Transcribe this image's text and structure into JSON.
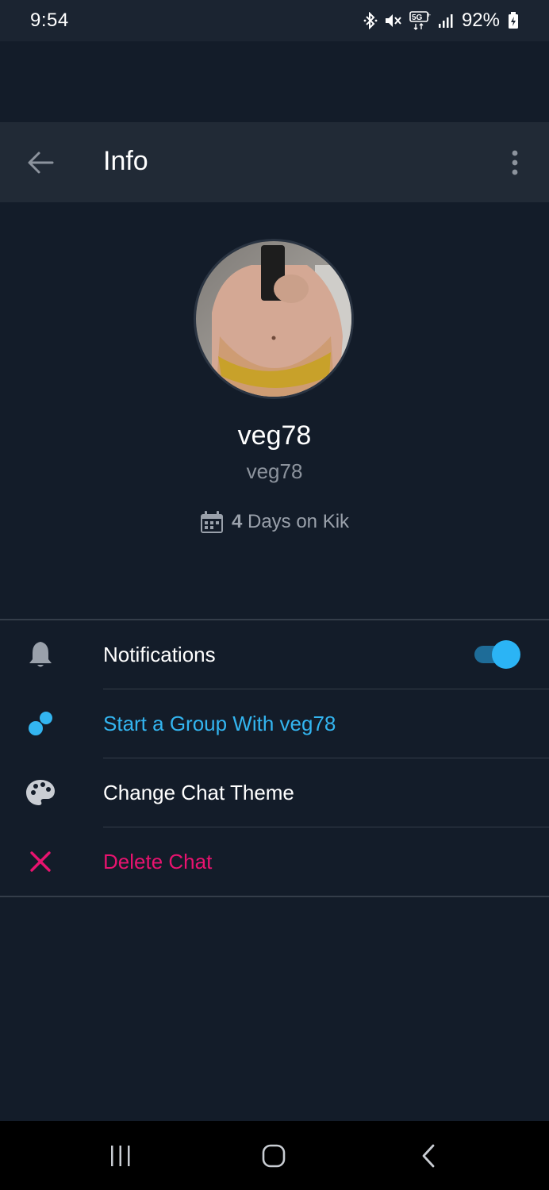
{
  "status_bar": {
    "time": "9:54",
    "battery": "92%",
    "icons": [
      "bluetooth-icon",
      "mute-icon",
      "5g-icon",
      "signal-icon",
      "battery-charging-icon"
    ]
  },
  "app_bar": {
    "title": "Info",
    "back_icon": "arrow-left-icon",
    "more_icon": "more-vertical-icon"
  },
  "profile": {
    "display_name": "veg78",
    "username": "veg78",
    "days_count": "4",
    "days_suffix": "Days on Kik",
    "calendar_icon": "calendar-icon"
  },
  "menu": {
    "notifications": {
      "label": "Notifications",
      "icon": "bell-icon",
      "enabled": true
    },
    "start_group": {
      "label": "Start a Group With veg78",
      "icon": "group-dots-icon"
    },
    "change_theme": {
      "label": "Change Chat Theme",
      "icon": "palette-icon"
    },
    "delete_chat": {
      "label": "Delete Chat",
      "icon": "close-icon"
    }
  },
  "colors": {
    "background": "#131c29",
    "app_bar": "#212a36",
    "accent_blue": "#33b5f0",
    "delete_pink": "#e8136f",
    "toggle_track": "#1e6c98",
    "muted_text": "#8c939d"
  },
  "nav_bar": {
    "buttons": [
      "recent-apps-icon",
      "home-icon",
      "back-icon"
    ]
  }
}
